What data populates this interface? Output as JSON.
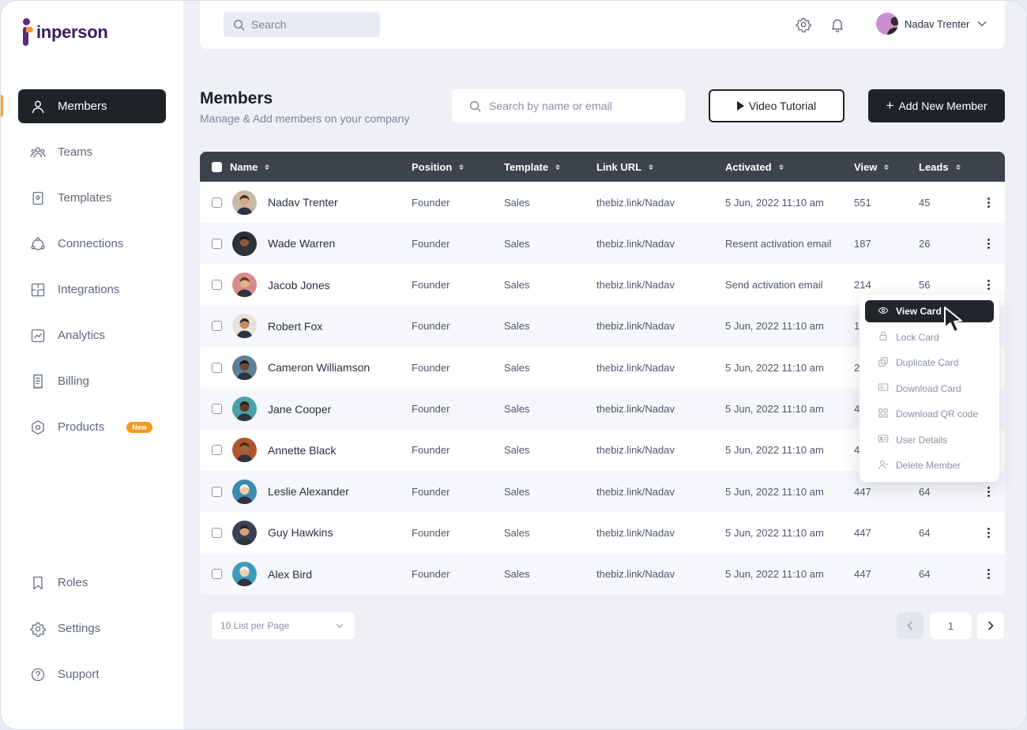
{
  "brand": {
    "name": "inperson"
  },
  "topbar": {
    "search_placeholder": "Search",
    "user_name": "Nadav Trenter"
  },
  "sidebar": {
    "items": [
      {
        "label": "Members",
        "icon": "user-icon"
      },
      {
        "label": "Teams",
        "icon": "users-icon"
      },
      {
        "label": "Templates",
        "icon": "template-icon"
      },
      {
        "label": "Connections",
        "icon": "connections-icon"
      },
      {
        "label": "Integrations",
        "icon": "puzzle-icon"
      },
      {
        "label": "Analytics",
        "icon": "chart-icon"
      },
      {
        "label": "Billing",
        "icon": "receipt-icon"
      },
      {
        "label": "Products",
        "icon": "box-icon",
        "badge": "New"
      }
    ],
    "bottom_items": [
      {
        "label": "Roles",
        "icon": "bookmark-icon"
      },
      {
        "label": "Settings",
        "icon": "gear-icon"
      },
      {
        "label": "Support",
        "icon": "help-icon"
      }
    ]
  },
  "header": {
    "title": "Members",
    "subtitle": "Manage & Add members on your company",
    "search_placeholder": "Search by name or email",
    "tutorial_label": "Video Tutorial",
    "add_label": "Add New Member"
  },
  "table": {
    "columns": [
      "Name",
      "Position",
      "Template",
      "Link URL",
      "Activated",
      "View",
      "Leads"
    ],
    "rows": [
      {
        "name": "Nadav Trenter",
        "position": "Founder",
        "template": "Sales",
        "link": "thebiz.link/Nadav",
        "activated": "5 Jun, 2022 11:10 am",
        "view": "551",
        "leads": "45",
        "avatar_bg": "#c8b9a6"
      },
      {
        "name": "Wade Warren",
        "position": "Founder",
        "template": "Sales",
        "link": "thebiz.link/Nadav",
        "activated": "Resent activation email",
        "view": "187",
        "leads": "26",
        "avatar_bg": "#2e3138"
      },
      {
        "name": "Jacob Jones",
        "position": "Founder",
        "template": "Sales",
        "link": "thebiz.link/Nadav",
        "activated": "Send activation email",
        "view": "214",
        "leads": "56",
        "avatar_bg": "#d98b8b"
      },
      {
        "name": "Robert Fox",
        "position": "Founder",
        "template": "Sales",
        "link": "thebiz.link/Nadav",
        "activated": "5 Jun, 2022 11:10 am",
        "view": "1",
        "leads": "",
        "avatar_bg": "#e8e2dc"
      },
      {
        "name": "Cameron Williamson",
        "position": "Founder",
        "template": "Sales",
        "link": "thebiz.link/Nadav",
        "activated": "5 Jun, 2022 11:10 am",
        "view": "2",
        "leads": "",
        "avatar_bg": "#5f7f96"
      },
      {
        "name": "Jane Cooper",
        "position": "Founder",
        "template": "Sales",
        "link": "thebiz.link/Nadav",
        "activated": "5 Jun, 2022 11:10 am",
        "view": "4",
        "leads": "",
        "avatar_bg": "#4ca0a8"
      },
      {
        "name": "Annette Black",
        "position": "Founder",
        "template": "Sales",
        "link": "thebiz.link/Nadav",
        "activated": "5 Jun, 2022 11:10 am",
        "view": "4",
        "leads": "",
        "avatar_bg": "#b0562e"
      },
      {
        "name": "Leslie Alexander",
        "position": "Founder",
        "template": "Sales",
        "link": "thebiz.link/Nadav",
        "activated": "5 Jun, 2022 11:10 am",
        "view": "447",
        "leads": "64",
        "avatar_bg": "#3e8bb0"
      },
      {
        "name": "Guy Hawkins",
        "position": "Founder",
        "template": "Sales",
        "link": "thebiz.link/Nadav",
        "activated": "5 Jun, 2022 11:10 am",
        "view": "447",
        "leads": "64",
        "avatar_bg": "#3a4256"
      },
      {
        "name": "Alex Bird",
        "position": "Founder",
        "template": "Sales",
        "link": "thebiz.link/Nadav",
        "activated": "5 Jun, 2022 11:10 am",
        "view": "447",
        "leads": "64",
        "avatar_bg": "#3c9cb8"
      }
    ]
  },
  "context_menu": {
    "items": [
      {
        "label": "View Card",
        "icon": "eye-icon",
        "active": true
      },
      {
        "label": "Lock Card",
        "icon": "lock-icon"
      },
      {
        "label": "Duplicate Card",
        "icon": "duplicate-icon"
      },
      {
        "label": "Download Card",
        "icon": "card-icon"
      },
      {
        "label": "Download QR code",
        "icon": "qr-icon"
      },
      {
        "label": "User Details",
        "icon": "id-card-icon"
      },
      {
        "label": "Delete Member",
        "icon": "user-remove-icon"
      }
    ]
  },
  "pagination": {
    "per_page": "10 List per Page",
    "current_page": "1"
  },
  "colors": {
    "dark": "#1f2328",
    "accent": "#f29b1b",
    "brand_purple": "#5b2a86"
  }
}
